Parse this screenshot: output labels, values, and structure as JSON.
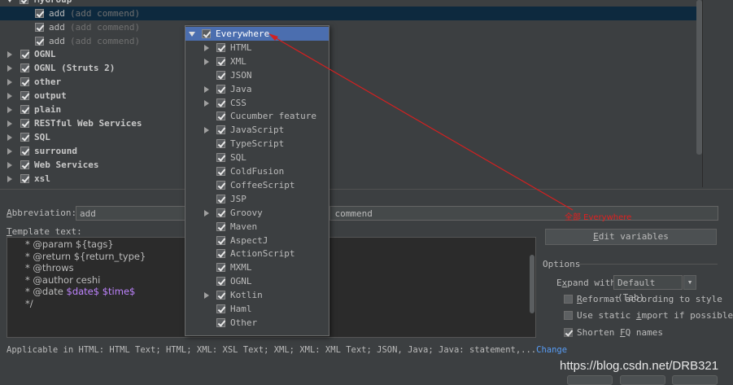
{
  "tree": {
    "group_label": "MyGroup",
    "items": [
      {
        "label": "add",
        "desc": "(add commend)",
        "selected": true
      },
      {
        "label": "add",
        "desc": "(add commend)",
        "selected": false
      },
      {
        "label": "add",
        "desc": "(add commend)",
        "selected": false
      }
    ],
    "groups": [
      "OGNL",
      "OGNL (Struts 2)",
      "other",
      "output",
      "plain",
      "RESTful Web Services",
      "SQL",
      "surround",
      "Web Services",
      "xsl"
    ]
  },
  "abbreviation": {
    "label": "Abbreviation:",
    "value": "add",
    "description_value": "add commend"
  },
  "template": {
    "label": "Template text:",
    "lines": [
      {
        "text": "* @param ${tags}",
        "var": ""
      },
      {
        "text": "* @return ${return_type}",
        "var": ""
      },
      {
        "text": "* @throws",
        "var": ""
      },
      {
        "text": "* @author ceshi",
        "var": ""
      },
      {
        "text": "* @date ",
        "var": "$date$ $time$"
      },
      {
        "text": "*/",
        "var": ""
      }
    ]
  },
  "applicable": {
    "text": "Applicable in HTML: HTML Text; HTML; XML: XSL Text; XML; XML: XML Text; JSON, Java; Java: statement,...",
    "link": "Change"
  },
  "options": {
    "edit_variables": "Edit variables",
    "title": "Options",
    "expand_with_label": "Expand with",
    "expand_with_value": "Default (Tab)",
    "reformat": {
      "label": "Reformat according to style",
      "checked": false
    },
    "static_import": {
      "label": "Use static import if possible",
      "checked": false
    },
    "shorten_fq": {
      "label": "Shorten FQ names",
      "checked": true
    }
  },
  "popup": {
    "items": [
      {
        "label": "Everywhere",
        "level": 0,
        "arrow": "down",
        "selected": true
      },
      {
        "label": "HTML",
        "level": 1,
        "arrow": "right"
      },
      {
        "label": "XML",
        "level": 1,
        "arrow": "right"
      },
      {
        "label": "JSON",
        "level": 1,
        "arrow": ""
      },
      {
        "label": "Java",
        "level": 1,
        "arrow": "right"
      },
      {
        "label": "CSS",
        "level": 1,
        "arrow": "right"
      },
      {
        "label": "Cucumber feature",
        "level": 1,
        "arrow": ""
      },
      {
        "label": "JavaScript",
        "level": 1,
        "arrow": "right"
      },
      {
        "label": "TypeScript",
        "level": 1,
        "arrow": ""
      },
      {
        "label": "SQL",
        "level": 1,
        "arrow": ""
      },
      {
        "label": "ColdFusion",
        "level": 1,
        "arrow": ""
      },
      {
        "label": "CoffeeScript",
        "level": 1,
        "arrow": ""
      },
      {
        "label": "JSP",
        "level": 1,
        "arrow": ""
      },
      {
        "label": "Groovy",
        "level": 1,
        "arrow": "right"
      },
      {
        "label": "Maven",
        "level": 1,
        "arrow": ""
      },
      {
        "label": "AspectJ",
        "level": 1,
        "arrow": ""
      },
      {
        "label": "ActionScript",
        "level": 1,
        "arrow": ""
      },
      {
        "label": "MXML",
        "level": 1,
        "arrow": ""
      },
      {
        "label": "OGNL",
        "level": 1,
        "arrow": ""
      },
      {
        "label": "Kotlin",
        "level": 1,
        "arrow": "right"
      },
      {
        "label": "Haml",
        "level": 1,
        "arrow": ""
      },
      {
        "label": "Other",
        "level": 1,
        "arrow": ""
      }
    ]
  },
  "annotation": {
    "text": "全部 Everywhere",
    "color": "#e02020"
  },
  "watermark": "https://blog.csdn.net/DRB321"
}
